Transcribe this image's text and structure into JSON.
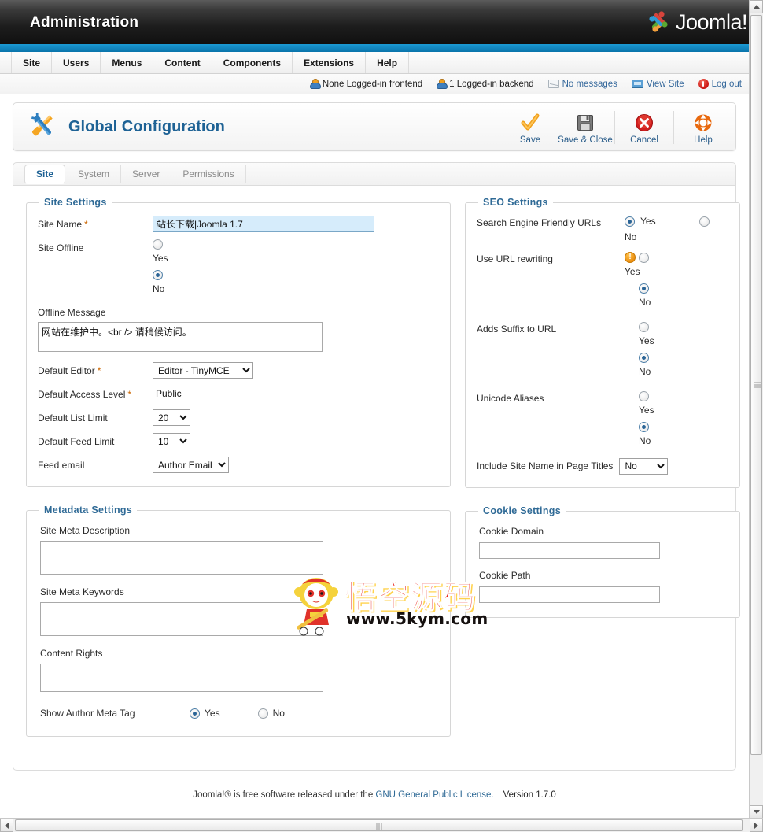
{
  "header": {
    "admin_title": "Administration",
    "logo_text": "Joomla!"
  },
  "menubar": {
    "items": [
      {
        "label": "Site"
      },
      {
        "label": "Users"
      },
      {
        "label": "Menus"
      },
      {
        "label": "Content"
      },
      {
        "label": "Components"
      },
      {
        "label": "Extensions"
      },
      {
        "label": "Help"
      }
    ]
  },
  "statusbar": {
    "frontend_users": "None Logged-in frontend",
    "backend_users": "1 Logged-in backend",
    "messages": "No messages",
    "view_site": "View Site",
    "logout": "Log out"
  },
  "page": {
    "title": "Global Configuration"
  },
  "toolbar": {
    "save": "Save",
    "save_close": "Save & Close",
    "cancel": "Cancel",
    "help": "Help"
  },
  "tabs": [
    {
      "label": "Site",
      "active": true
    },
    {
      "label": "System",
      "active": false
    },
    {
      "label": "Server",
      "active": false
    },
    {
      "label": "Permissions",
      "active": false
    }
  ],
  "site_settings": {
    "legend": "Site Settings",
    "site_name_label": "Site Name",
    "site_name_value": "站长下载|Joomla 1.7",
    "site_offline_label": "Site Offline",
    "offline_yes": "Yes",
    "offline_no": "No",
    "offline_selected": "No",
    "offline_message_label": "Offline Message",
    "offline_message_value": "网站在维护中。<br /> 请稍候访问。",
    "default_editor_label": "Default Editor",
    "default_editor_value": "Editor - TinyMCE",
    "default_access_label": "Default Access Level",
    "default_access_value": "Public",
    "default_list_limit_label": "Default List Limit",
    "default_list_limit_value": "20",
    "default_feed_limit_label": "Default Feed Limit",
    "default_feed_limit_value": "10",
    "feed_email_label": "Feed email",
    "feed_email_value": "Author Email"
  },
  "metadata_settings": {
    "legend": "Metadata Settings",
    "meta_description_label": "Site Meta Description",
    "meta_description_value": "",
    "meta_keywords_label": "Site Meta Keywords",
    "meta_keywords_value": "",
    "content_rights_label": "Content Rights",
    "content_rights_value": "",
    "show_author_label": "Show Author Meta Tag",
    "show_author_yes": "Yes",
    "show_author_no": "No",
    "show_author_selected": "Yes"
  },
  "seo_settings": {
    "legend": "SEO Settings",
    "sef_label": "Search Engine Friendly URLs",
    "sef_yes": "Yes",
    "sef_no": "No",
    "sef_selected": "Yes",
    "rewrite_label": "Use URL rewriting",
    "rewrite_yes": "Yes",
    "rewrite_no": "No",
    "rewrite_selected": "No",
    "suffix_label": "Adds Suffix to URL",
    "suffix_yes": "Yes",
    "suffix_no": "No",
    "suffix_selected": "No",
    "unicode_label": "Unicode Aliases",
    "unicode_yes": "Yes",
    "unicode_no": "No",
    "unicode_selected": "No",
    "sitename_titles_label": "Include Site Name in Page Titles",
    "sitename_titles_value": "No"
  },
  "cookie_settings": {
    "legend": "Cookie Settings",
    "domain_label": "Cookie Domain",
    "domain_value": "",
    "path_label": "Cookie Path",
    "path_value": ""
  },
  "watermark": {
    "cn_text": "悟空源码",
    "url_text": "www.5kym.com"
  },
  "footer": {
    "prefix": "Joomla!® is free software released under the ",
    "license_link": "GNU General Public License.",
    "version": "Version 1.7.0"
  },
  "colors": {
    "brand_blue": "#1e6295",
    "accent_orange": "#e8890a",
    "header_dark": "#1d1d1d",
    "strip_blue": "#1b9ad4",
    "focus_field": "#d6ecfb",
    "watermark_red": "#e8231b"
  }
}
